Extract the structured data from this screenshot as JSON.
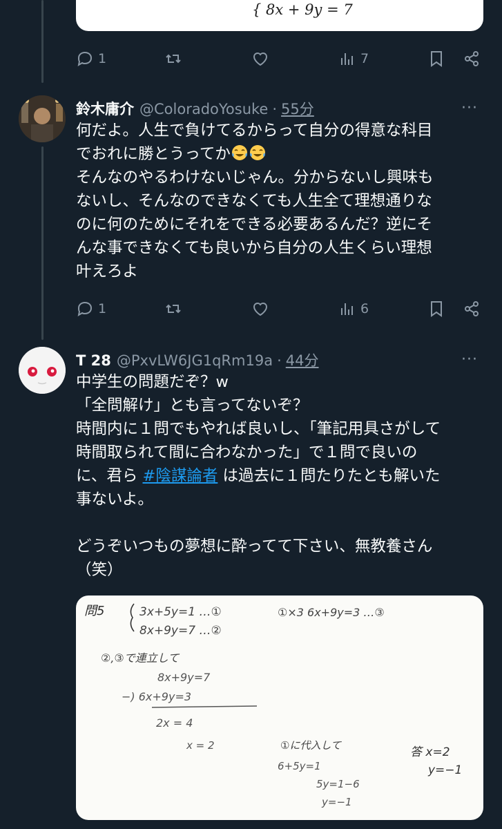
{
  "top_card": {
    "equation": "{ 8x + 9y = 7"
  },
  "tweets": [
    {
      "actions": {
        "reply_count": "1",
        "views": "7"
      }
    },
    {
      "name": "鈴木庸介",
      "handle": "@ColoradoYosuke",
      "dot": "·",
      "time": "55分",
      "more": "···",
      "lines": [
        "何だよ。人生で負けてるからって自分の得意な科目",
        "でおれに勝とうってか",
        "そんなのやるわけないじゃん。分からないし興味も",
        "ないし、そんなのできなくても人生全て理想通りな",
        "のに何のためにそれをできる必要あるんだ？逆にそ",
        "んな事できなくても良いから自分の人生くらい理想",
        "叶えろよ"
      ],
      "actions": {
        "reply_count": "1",
        "views": "6"
      }
    },
    {
      "name": "T 28",
      "handle": "@PxvLW6JG1qRm19a",
      "dot": "·",
      "time": "44分",
      "more": "···",
      "lines": [
        "中学生の問題だぞ？w",
        "「全問解け」とも言ってないぞ？",
        "時間内に１問でもやれば良いし、「筆記用具さがして",
        "時間取られて間に合わなかった」で１問で良いの",
        "に、君ら ",
        "#陰謀論者",
        " は過去に１問たりたとも解いた",
        "事ないよ。",
        "どうぞいつもの夢想に酔ってて下さい、無教養さん",
        "（笑）"
      ]
    }
  ],
  "icons": [
    "reply-icon",
    "retweet-icon",
    "like-icon",
    "views-icon",
    "bookmark-icon",
    "share-icon"
  ],
  "handwritten_sheet": {
    "l1": "問5",
    "l2": "3x+5y=1 …①",
    "l3": "8x+9y=7 …②",
    "l4": "①×3  6x+9y=3 …③",
    "l5": "②,③で連立して",
    "l6": "8x+9y=7",
    "l7": "−) 6x+9y=3",
    "l8": "2x = 4",
    "l9": "x = 2",
    "l10": "①に代入して",
    "l11": "6+5y=1",
    "l12": "5y=1−6",
    "l13": "y=−1",
    "l14": "答 x=2",
    "l15": "y=−1"
  }
}
